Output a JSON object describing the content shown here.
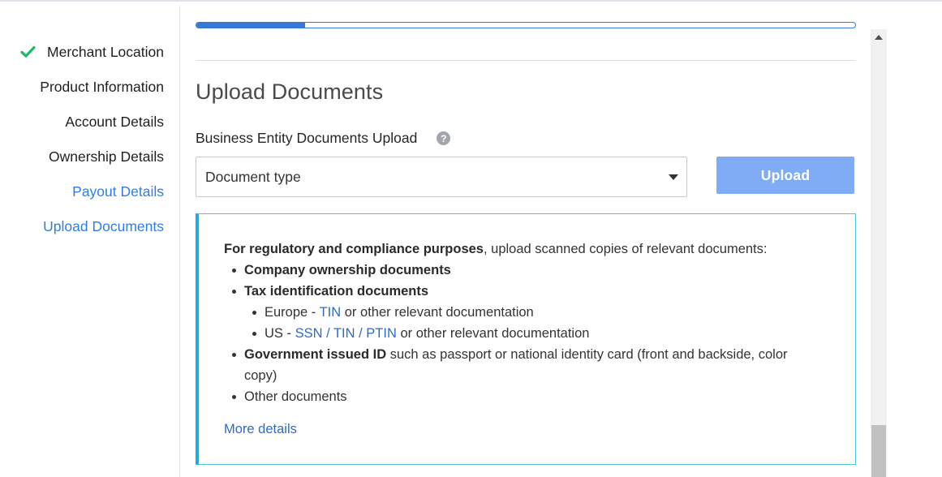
{
  "sidebar": {
    "items": [
      {
        "label": "Merchant Location",
        "state": "completed"
      },
      {
        "label": "Product Information",
        "state": "default"
      },
      {
        "label": "Account Details",
        "state": "default"
      },
      {
        "label": "Ownership Details",
        "state": "default"
      },
      {
        "label": "Payout Details",
        "state": "link"
      },
      {
        "label": "Upload Documents",
        "state": "link"
      }
    ]
  },
  "progress": {
    "fraction": 0.165
  },
  "main": {
    "title": "Upload Documents",
    "field_label": "Business Entity Documents Upload",
    "help_icon": "question-circle-icon",
    "document_select": {
      "value": "Document type"
    },
    "upload_label": "Upload"
  },
  "info": {
    "intro_bold": "For regulatory and compliance purposes",
    "intro_rest": ", upload scanned copies of relevant documents:",
    "ownership": "Company ownership documents",
    "tax": "Tax identification documents",
    "europe_prefix": "Europe - ",
    "europe_link": "TIN",
    "europe_suffix": " or other relevant documentation",
    "us_prefix": "US - ",
    "us_link": "SSN / TIN / PTIN",
    "us_suffix": " or other relevant documentation",
    "gov_bold": "Government issued ID",
    "gov_rest": " such as passport or national identity card (front and backside, color copy)",
    "other": "Other documents",
    "more_details": "More details"
  },
  "colors": {
    "accent": "#3a78d6",
    "link": "#2f7de1",
    "check": "#1db86b",
    "upload_button": "#80abf5",
    "info_border": "#29a9d6"
  }
}
